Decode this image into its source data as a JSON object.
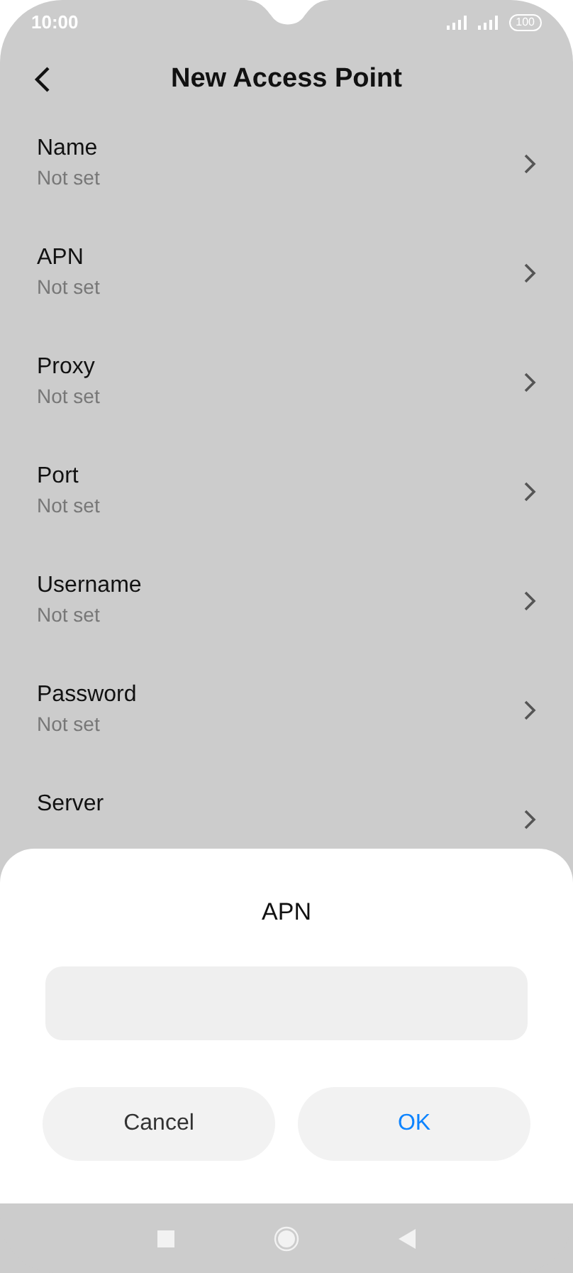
{
  "status_bar": {
    "time": "10:00",
    "battery": "100"
  },
  "header": {
    "title": "New Access Point"
  },
  "settings": [
    {
      "title": "Name",
      "value": "Not set"
    },
    {
      "title": "APN",
      "value": "Not set"
    },
    {
      "title": "Proxy",
      "value": "Not set"
    },
    {
      "title": "Port",
      "value": "Not set"
    },
    {
      "title": "Username",
      "value": "Not set"
    },
    {
      "title": "Password",
      "value": "Not set"
    },
    {
      "title": "Server"
    }
  ],
  "dialog": {
    "title": "APN",
    "buttons": [
      {
        "label": "Cancel",
        "kind": "cancel"
      },
      {
        "label": "OK",
        "kind": "confirm"
      }
    ]
  }
}
